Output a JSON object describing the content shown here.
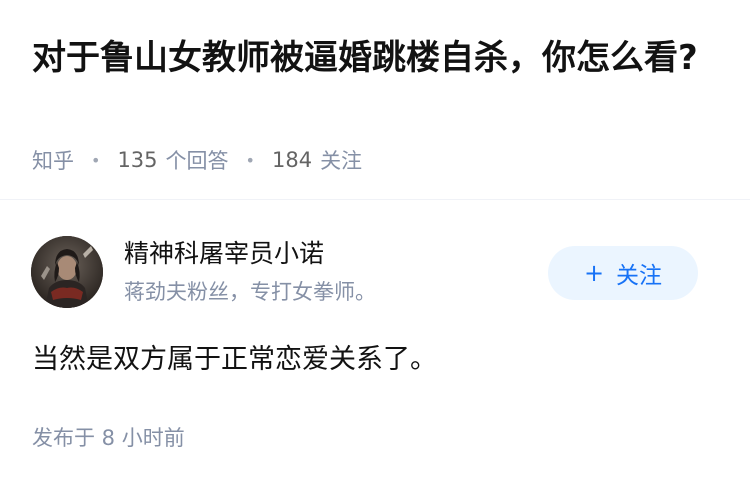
{
  "question": {
    "title": "对于鲁山女教师被逼婚跳楼自杀，你怎么看?",
    "source": "知乎",
    "answer_count": "135",
    "answer_label": "个回答",
    "follower_count": "184",
    "follower_label": "关注"
  },
  "answer": {
    "author": {
      "name": "精神科屠宰员小诺",
      "bio": "蒋劲夫粉丝，专打女拳师。"
    },
    "follow_button": {
      "icon": "+",
      "label": "关注"
    },
    "content": "当然是双方属于正常恋爱关系了。",
    "published": "发布于  8 小时前"
  },
  "colors": {
    "title": "#121212",
    "meta": "#8590a6",
    "accent": "#1772f6",
    "accent_bg": "#ebf5ff"
  }
}
